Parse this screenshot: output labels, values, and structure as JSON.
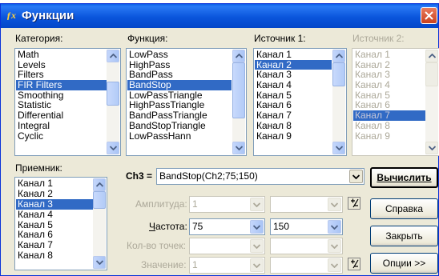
{
  "window": {
    "title": "Функции",
    "icon": "fx-icon"
  },
  "category": {
    "label": "Категория:",
    "items": [
      "Math",
      "Levels",
      "Filters",
      "FIR Filters",
      "Smoothing",
      "Statistic",
      "Differential",
      "Integral",
      "Cyclic"
    ],
    "selected": "FIR Filters"
  },
  "function": {
    "label": "Функция:",
    "items": [
      "LowPass",
      "HighPass",
      "BandPass",
      "BandStop",
      "LowPassTriangle",
      "HighPassTriangle",
      "BandPassTriangle",
      "BandStopTriangle",
      "LowPassHann"
    ],
    "selected": "BandStop"
  },
  "source1": {
    "label": "Источник 1:",
    "items": [
      "Канал 1",
      "Канал 2",
      "Канал 3",
      "Канал 4",
      "Канал 5",
      "Канал 6",
      "Канал 7",
      "Канал 8",
      "Канал 9"
    ],
    "selected": "Канал 2"
  },
  "source2": {
    "label": "Источник 2:",
    "items": [
      "Канал 1",
      "Канал 2",
      "Канал 3",
      "Канал 4",
      "Канал 5",
      "Канал 6",
      "Канал 7",
      "Канал 8",
      "Канал 9"
    ],
    "selected": "Канал 7"
  },
  "receiver": {
    "label": "Приемник:",
    "items": [
      "Канал 1",
      "Канал 2",
      "Канал 3",
      "Канал 4",
      "Канал 5",
      "Канал 6",
      "Канал 7",
      "Канал 8"
    ],
    "selected": "Канал 3"
  },
  "formula": {
    "label": "Ch3 =",
    "value": "BandStop(Ch2;75;150)"
  },
  "params": {
    "amplitude": {
      "label": "Амплитуда:",
      "value1": "1",
      "value2": ""
    },
    "frequency": {
      "label": "Частота:",
      "value1": "75",
      "value2": "150"
    },
    "points": {
      "label": "Кол-во точек:",
      "value1": "",
      "value2": ""
    },
    "value": {
      "label": "Значение:",
      "value1": "1",
      "value2": ""
    }
  },
  "buttons": {
    "calculate": "Вычислить",
    "help": "Справка",
    "close": "Закрыть",
    "options": "Опции >>"
  },
  "colors": {
    "selection": "#316ac5",
    "titlebar": "#0a55dc",
    "dialog": "#ece9d8"
  }
}
